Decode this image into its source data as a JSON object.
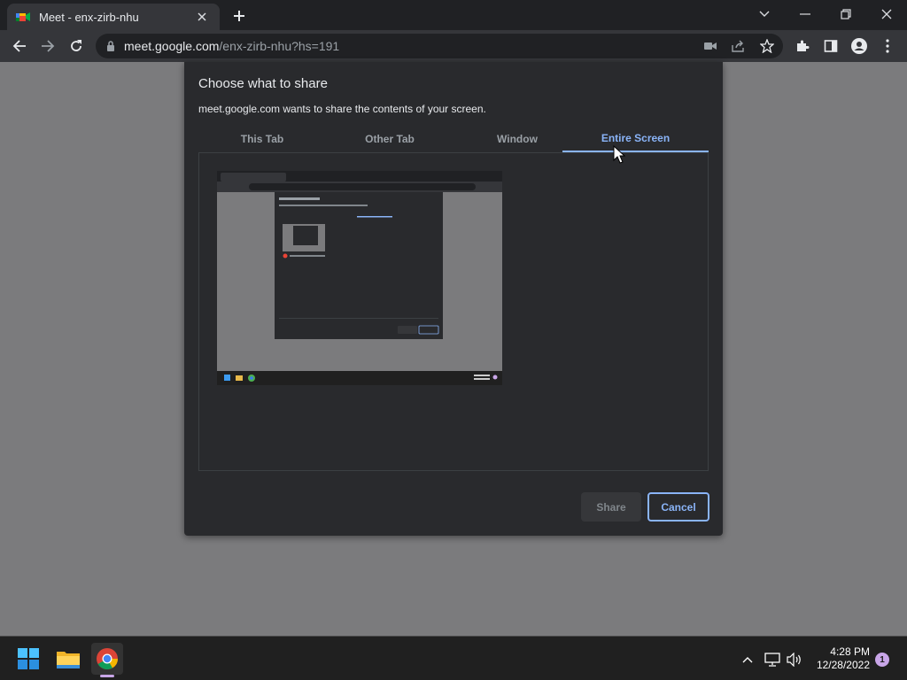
{
  "browser": {
    "tab_title": "Meet - enx-zirb-nhu",
    "url_host": "meet.google.com",
    "url_path": "/enx-zirb-nhu?hs=191"
  },
  "dialog": {
    "title": "Choose what to share",
    "subtitle": "meet.google.com wants to share the contents of your screen.",
    "tabs": [
      {
        "label": "This Tab",
        "active": false
      },
      {
        "label": "Other Tab",
        "active": false
      },
      {
        "label": "Window",
        "active": false
      },
      {
        "label": "Entire Screen",
        "active": true
      }
    ],
    "share_label": "Share",
    "cancel_label": "Cancel"
  },
  "taskbar": {
    "time": "4:28 PM",
    "date": "12/28/2022",
    "notification_count": "1"
  },
  "colors": {
    "accent": "#8ab4f8",
    "dialog_bg": "#292a2d",
    "page_dim": "#7b7b7d"
  }
}
